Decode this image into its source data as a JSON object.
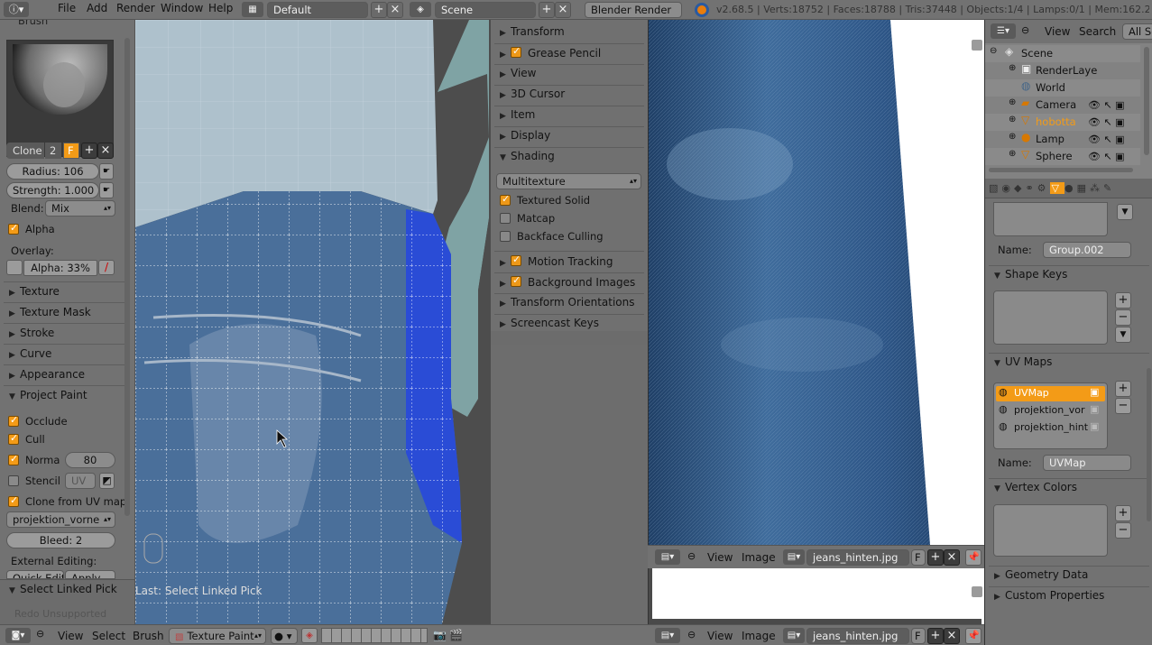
{
  "topbar": {
    "menus": [
      "File",
      "Add",
      "Render",
      "Window",
      "Help"
    ],
    "layout": "Default",
    "scene": "Scene",
    "engine": "Blender Render",
    "stats": "v2.68.5 | Verts:18752 | Faces:18788 | Tris:37448 | Objects:1/4 | Lamps:0/1 | Mem:162.29M (1"
  },
  "toolshelf": {
    "brush_header": "Brush",
    "brush_name": "Clone",
    "brush_users": "2",
    "fake_user": "F",
    "radius": "Radius: 106",
    "strength": "Strength: 1.000",
    "blend_label": "Blend:",
    "blend_value": "Mix",
    "alpha_label": "Alpha",
    "overlay_label": "Overlay:",
    "overlay_alpha": "Alpha: 33%",
    "panels": [
      "Texture",
      "Texture Mask",
      "Stroke",
      "Curve",
      "Appearance",
      "Project Paint"
    ],
    "occlude": "Occlude",
    "cull": "Cull",
    "normal": "Norma",
    "normal_value": "80",
    "stencil": "Stencil",
    "stencil_uv": "UV",
    "clone_from_uv": "Clone from UV map",
    "uv_select": "projektion_vorne",
    "bleed": "Bleed: 2",
    "external_editing": "External Editing:",
    "quick_edit": "Quick Edit",
    "apply": "Apply",
    "select_linked": "Select Linked Pick",
    "redo": "Redo Unsupported"
  },
  "viewport": {
    "last_op": "Last: Select Linked Pick"
  },
  "properties_panel": {
    "items": [
      "Transform",
      "Grease Pencil",
      "View",
      "3D Cursor",
      "Item",
      "Display",
      "Shading"
    ],
    "shading_mode": "Multitexture",
    "textured_solid": "Textured Solid",
    "matcap": "Matcap",
    "backface": "Backface Culling",
    "items2": [
      "Motion Tracking",
      "Background Images",
      "Transform Orientations",
      "Screencast Keys"
    ]
  },
  "bottom_bar": {
    "view": "View",
    "select": "Select",
    "brush": "Brush",
    "mode": "Texture Paint"
  },
  "image_editor": {
    "view": "View",
    "image": "Image",
    "image_name": "jeans_hinten.jpg",
    "fake": "F"
  },
  "outliner": {
    "view": "View",
    "search": "Search",
    "filter": "All Sc",
    "items": [
      "Scene",
      "RenderLaye",
      "World",
      "Camera",
      "hobotta",
      "Lamp",
      "Sphere"
    ]
  },
  "data_props": {
    "name_label": "Name:",
    "group_name": "Group.002",
    "shape_keys": "Shape Keys",
    "uv_maps": "UV Maps",
    "uv_list": [
      "UVMap",
      "projektion_vor",
      "projektion_hint"
    ],
    "uv_name": "UVMap",
    "vertex_colors": "Vertex Colors",
    "geometry_data": "Geometry Data",
    "custom_props": "Custom Properties"
  }
}
